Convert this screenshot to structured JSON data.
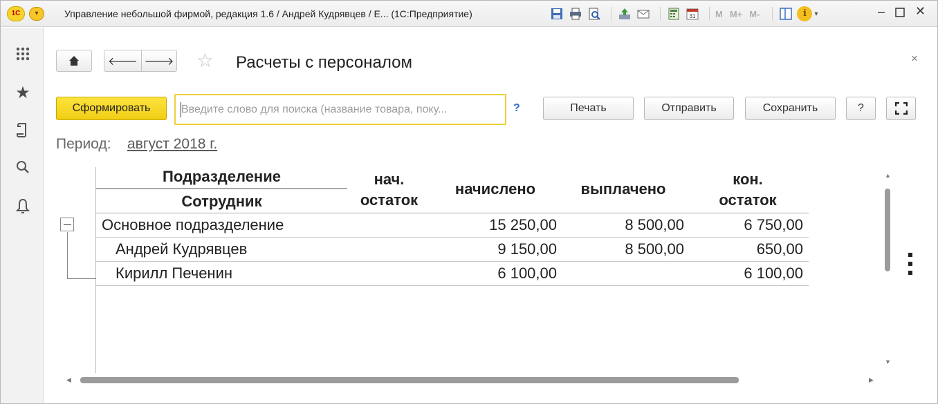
{
  "titlebar": {
    "logo": "1С",
    "title": "Управление небольшой фирмой, редакция 1.6 / Андрей Кудрявцев / Е...  (1С:Предприятие)",
    "memory_buttons": [
      "M",
      "M+",
      "M-"
    ],
    "info_icon": "i"
  },
  "icons": {
    "save": "save-icon",
    "print": "print-icon",
    "preview": "print-preview-icon",
    "upload": "upload-icon",
    "mail": "mail-icon",
    "calculator": "calculator-icon",
    "calendar": "calendar-icon",
    "calendar_day": "31"
  },
  "header": {
    "title": "Расчеты с персоналом",
    "close": "×"
  },
  "toolbar": {
    "generate_label": "Сформировать",
    "search_placeholder": "Введите слово для поиска (название товара, поку...",
    "search_help": "?",
    "print_label": "Печать",
    "send_label": "Отправить",
    "save_label": "Сохранить",
    "help_label": "?"
  },
  "period": {
    "label": "Период:",
    "value": "август 2018 г."
  },
  "report": {
    "columns": {
      "group1": "Подразделение",
      "group2": "Сотрудник",
      "opening1": "нач.",
      "opening2": "остаток",
      "accrued": "начислено",
      "paid": "выплачено",
      "closing1": "кон.",
      "closing2": "остаток"
    },
    "rows": [
      {
        "name": "Основное подразделение",
        "opening": "",
        "accrued": "15 250,00",
        "paid": "8 500,00",
        "closing": "6 750,00"
      },
      {
        "name": "Андрей Кудрявцев",
        "opening": "",
        "accrued": "9 150,00",
        "paid": "8 500,00",
        "closing": "650,00"
      },
      {
        "name": "Кирилл Печенин",
        "opening": "",
        "accrued": "6 100,00",
        "paid": "",
        "closing": "6 100,00"
      }
    ]
  }
}
